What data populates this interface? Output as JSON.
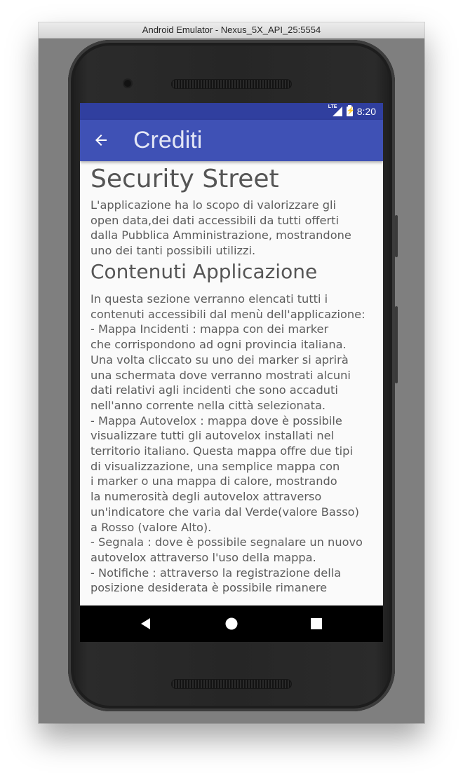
{
  "window": {
    "title": "Android Emulator - Nexus_5X_API_25:5554"
  },
  "status_bar": {
    "network_label": "LTE",
    "time": "8:20",
    "background_color": "#303f9f",
    "icons": [
      "lte-signal-icon",
      "battery-charging-icon"
    ]
  },
  "app_bar": {
    "title": "Crediti",
    "back_icon": "arrow-left-icon",
    "background_color": "#3f51b5"
  },
  "content": {
    "heading1": "Security Street",
    "intro_lines": [
      "L'applicazione ha lo scopo di valorizzare gli",
      "open data,dei dati accessibili da tutti offerti",
      "dalla Pubblica Amministrazione, mostrandone",
      "uno dei tanti possibili utilizzi."
    ],
    "heading2": "Contenuti Applicazione",
    "body_lines": [
      "In questa sezione verranno elencati tutti i",
      "contenuti accessibili dal menù dell'applicazione:",
      " - Mappa Incidenti : mappa con dei marker",
      "che corrispondono ad ogni provincia italiana.",
      "Una volta cliccato su uno dei marker si aprirà",
      "una schermata dove verranno mostrati alcuni",
      "dati relativi agli incidenti che sono accaduti",
      "nell'anno corrente nella città selezionata.",
      " - Mappa Autovelox : mappa dove è possibile",
      "visualizzare tutti gli autovelox installati nel",
      "territorio italiano. Questa mappa offre due tipi",
      "di visualizzazione, una semplice mappa con",
      "i marker o una mappa di calore, mostrando",
      "la numerosità degli autovelox attraverso",
      "un'indicatore che varia dal Verde(valore Basso)",
      "a Rosso (valore Alto).",
      " - Segnala : dove è possibile segnalare un nuovo",
      "autovelox attraverso l'uso della mappa.",
      " - Notifiche : attraverso la registrazione della",
      "posizione desiderata è possibile rimanere"
    ]
  },
  "nav_bar": {
    "buttons": [
      "back-triangle-icon",
      "home-circle-icon",
      "recents-square-icon"
    ]
  }
}
